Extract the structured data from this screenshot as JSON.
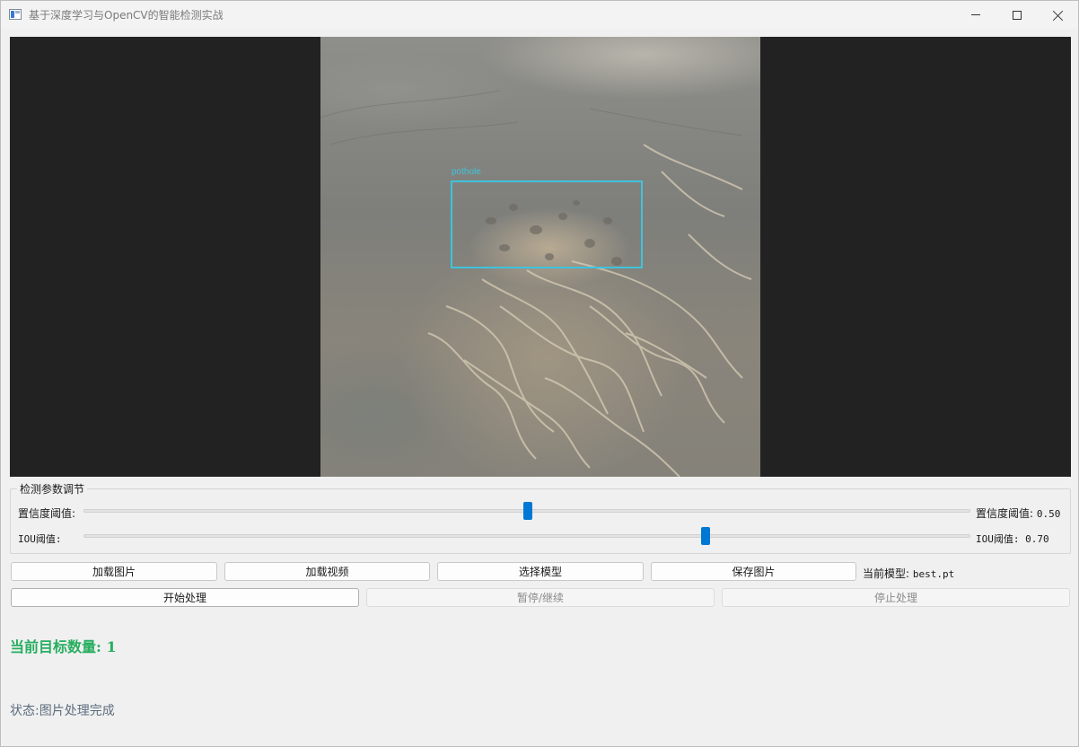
{
  "window": {
    "title": "基于深度学习与OpenCV的智能检测实战",
    "icon": "app-window-icon"
  },
  "display": {
    "detection": {
      "label": "pothole",
      "box_color": "#3fc3dd"
    }
  },
  "params": {
    "group_title": "检测参数调节",
    "confidence": {
      "label": "置信度阈值:",
      "value_label": "置信度阈值:",
      "value": "0.50",
      "fraction": 0.5
    },
    "iou": {
      "label": "IOU阈值:",
      "value_label": "IOU阈值:",
      "value": "0.70",
      "fraction": 0.7
    }
  },
  "buttons": {
    "load_image": "加载图片",
    "load_video": "加载视频",
    "select_model": "选择模型",
    "save_image": "保存图片",
    "start": "开始处理",
    "pause_resume": "暂停/继续",
    "stop": "停止处理"
  },
  "model": {
    "label": "当前模型:",
    "name": "best.pt"
  },
  "count": {
    "label": "当前目标数量:",
    "value": "1",
    "color": "#27ae60"
  },
  "status": {
    "label": "状态:",
    "text": "图片处理完成",
    "color": "#5d6d7e"
  }
}
